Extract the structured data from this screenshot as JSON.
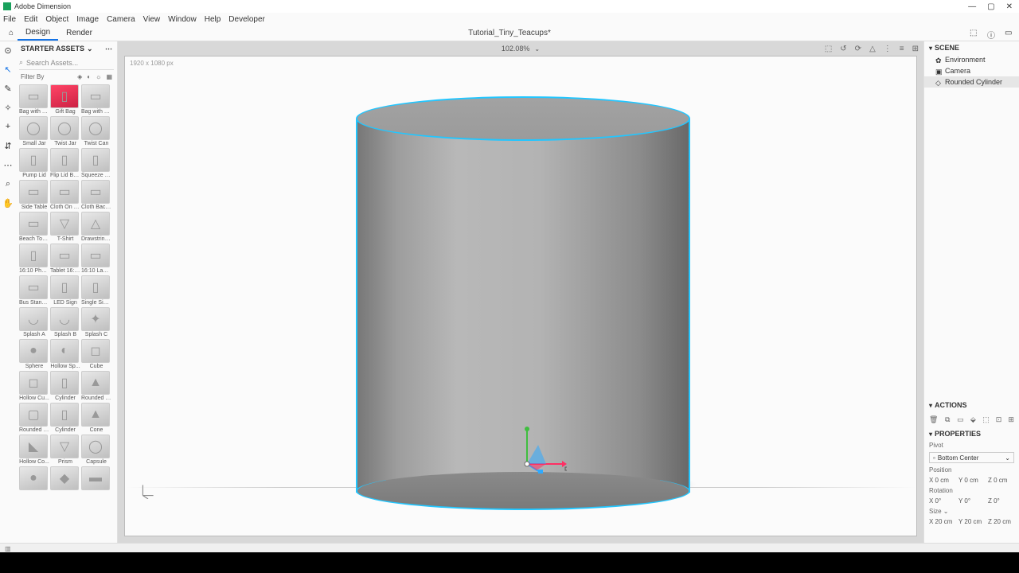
{
  "app_name": "Adobe Dimension",
  "window_controls": {
    "min": "—",
    "max": "▢",
    "close": "✕"
  },
  "menu": [
    "File",
    "Edit",
    "Object",
    "Image",
    "Camera",
    "View",
    "Window",
    "Help",
    "Developer"
  ],
  "modes": {
    "home_icon": "⌂",
    "design": "Design",
    "render": "Render"
  },
  "document_title": "Tutorial_Tiny_Teacups*",
  "zoom": "102.08%",
  "help_icons": {
    "cloud": "⬚",
    "info": "ⓘ",
    "chat": "▭"
  },
  "tools": [
    {
      "name": "select",
      "glyph": "⊙"
    },
    {
      "name": "move",
      "glyph": "↖"
    },
    {
      "name": "eyedropper",
      "glyph": "✎"
    },
    {
      "name": "magicwand",
      "glyph": "✧"
    },
    {
      "name": "add",
      "glyph": "+"
    },
    {
      "name": "align",
      "glyph": "⇵"
    },
    {
      "name": "dash",
      "glyph": "⋯"
    },
    {
      "name": "zoom",
      "glyph": "⌕"
    },
    {
      "name": "hand",
      "glyph": "✋"
    }
  ],
  "assets_panel": {
    "title": "STARTER ASSETS",
    "search_placeholder": "Search Assets...",
    "filter_label": "Filter By"
  },
  "assets": [
    {
      "label": "Bag with W..."
    },
    {
      "label": "Gift Bag"
    },
    {
      "label": "Bag with C..."
    },
    {
      "label": "Small Jar"
    },
    {
      "label": "Twist Jar"
    },
    {
      "label": "Twist Can"
    },
    {
      "label": "Pump Lid"
    },
    {
      "label": "Flip Lid Bo..."
    },
    {
      "label": "Squeeze T..."
    },
    {
      "label": "Side Table"
    },
    {
      "label": "Cloth On T..."
    },
    {
      "label": "Cloth Back..."
    },
    {
      "label": "Beach Tow..."
    },
    {
      "label": "T-Shirt"
    },
    {
      "label": "Drawstring..."
    },
    {
      "label": "16:10 Phone"
    },
    {
      "label": "Tablet 16:10"
    },
    {
      "label": "16:10 Lapt..."
    },
    {
      "label": "Bus Stand..."
    },
    {
      "label": "LED Sign"
    },
    {
      "label": "Single Sign..."
    },
    {
      "label": "Splash A"
    },
    {
      "label": "Splash B"
    },
    {
      "label": "Splash C"
    },
    {
      "label": "Sphere"
    },
    {
      "label": "Hollow Sp..."
    },
    {
      "label": "Cube"
    },
    {
      "label": "Hollow Cu..."
    },
    {
      "label": "Cylinder"
    },
    {
      "label": "Rounded C..."
    },
    {
      "label": "Rounded C..."
    },
    {
      "label": "Cylinder"
    },
    {
      "label": "Cone"
    },
    {
      "label": "Hollow Co..."
    },
    {
      "label": "Prism"
    },
    {
      "label": "Capsule"
    },
    {
      "label": ""
    },
    {
      "label": ""
    },
    {
      "label": ""
    }
  ],
  "canvas": {
    "dimensions": "1920 x 1080 px",
    "top_icons": [
      "⬚",
      "↺",
      "⟳",
      "△",
      "⋮",
      "≡",
      "⊞"
    ]
  },
  "scene": {
    "title": "SCENE",
    "items": [
      {
        "label": "Environment",
        "icon": "✿"
      },
      {
        "label": "Camera",
        "icon": "▣"
      },
      {
        "label": "Rounded Cylinder",
        "icon": "◇",
        "selected": true
      }
    ]
  },
  "actions": {
    "title": "ACTIONS",
    "icons": [
      "🗑",
      "⧉",
      "▭",
      "⬙",
      "⬚",
      "⊡",
      "⊞"
    ]
  },
  "properties": {
    "title": "PROPERTIES",
    "pivot_label": "Pivot",
    "pivot_value": "Bottom Center",
    "position_label": "Position",
    "position": {
      "x": "X  0 cm",
      "y": "Y  0 cm",
      "z": "Z  0 cm"
    },
    "rotation_label": "Rotation",
    "rotation": {
      "x": "X  0°",
      "y": "Y  0°",
      "z": "Z  0°"
    },
    "size_label": "Size ⌄",
    "size": {
      "x": "X  20 cm",
      "y": "Y  20 cm",
      "z": "Z  20 cm"
    }
  }
}
